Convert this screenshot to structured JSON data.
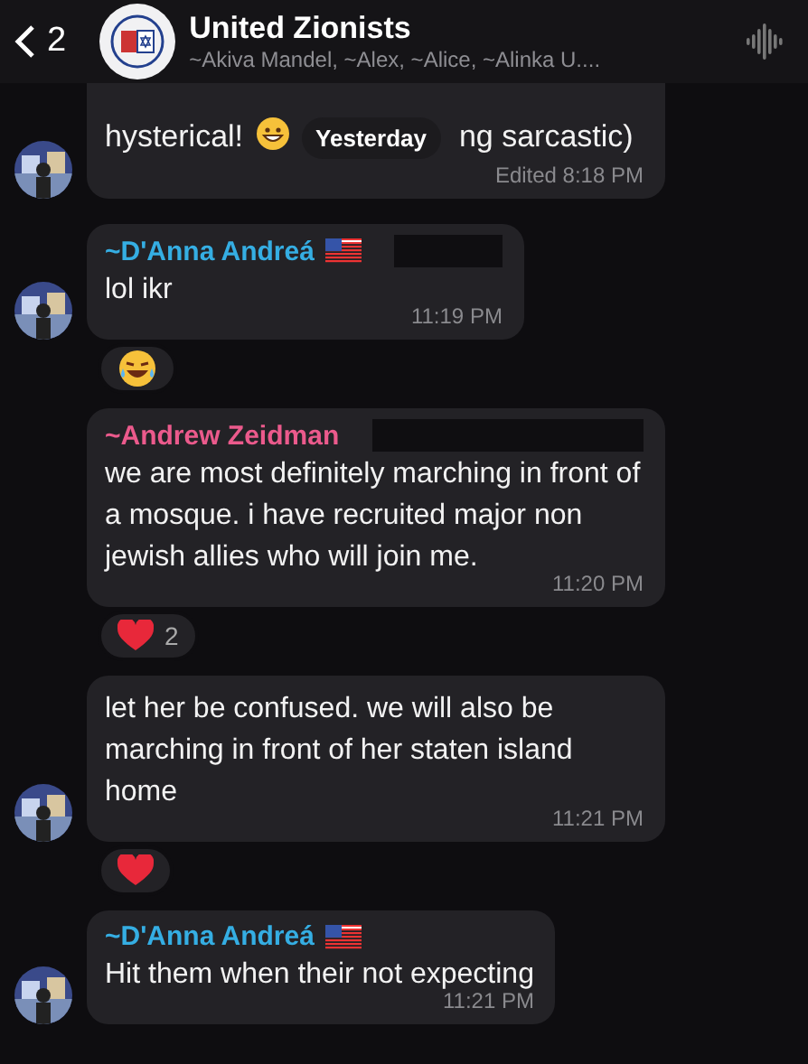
{
  "header": {
    "back_count": "2",
    "title": "United Zionists",
    "subtitle": "~Akiva Mandel, ~Alex, ~Alice, ~Alinka U...."
  },
  "date_pill": "Yesterday",
  "messages": [
    {
      "kind": "partial",
      "parts": [
        "hysterical!",
        "ng sarcastic)"
      ],
      "time": "Edited 8:18 PM",
      "avatar": true
    },
    {
      "kind": "message",
      "sender": "~D'Anna Andreá",
      "color": "#35aee3",
      "flag": true,
      "redacted": true,
      "lines": [
        "lol ikr"
      ],
      "time": "11:19 PM",
      "avatar": true,
      "reaction": {
        "kind": "laughing"
      }
    },
    {
      "kind": "message",
      "sender": "~Andrew Zeidman",
      "color": "#eb5a8c",
      "flag": false,
      "redacted": true,
      "lines": [
        "we are most definitely marching in front of a mosque. i have recruited major non jewish allies who will join me."
      ],
      "time": "11:20 PM",
      "avatar": false,
      "reaction": {
        "kind": "heart",
        "count": "2"
      }
    },
    {
      "kind": "message",
      "lines": [
        "let her be confused.  we will also be marching in front of her staten island home"
      ],
      "time": "11:21 PM",
      "avatar": true,
      "reaction": {
        "kind": "heart"
      }
    },
    {
      "kind": "message",
      "sender": "~D'Anna Andreá",
      "color": "#35aee3",
      "flag": true,
      "lines": [
        "Hit them when their not expecting"
      ],
      "time": "11:21 PM",
      "avatar": true
    }
  ]
}
